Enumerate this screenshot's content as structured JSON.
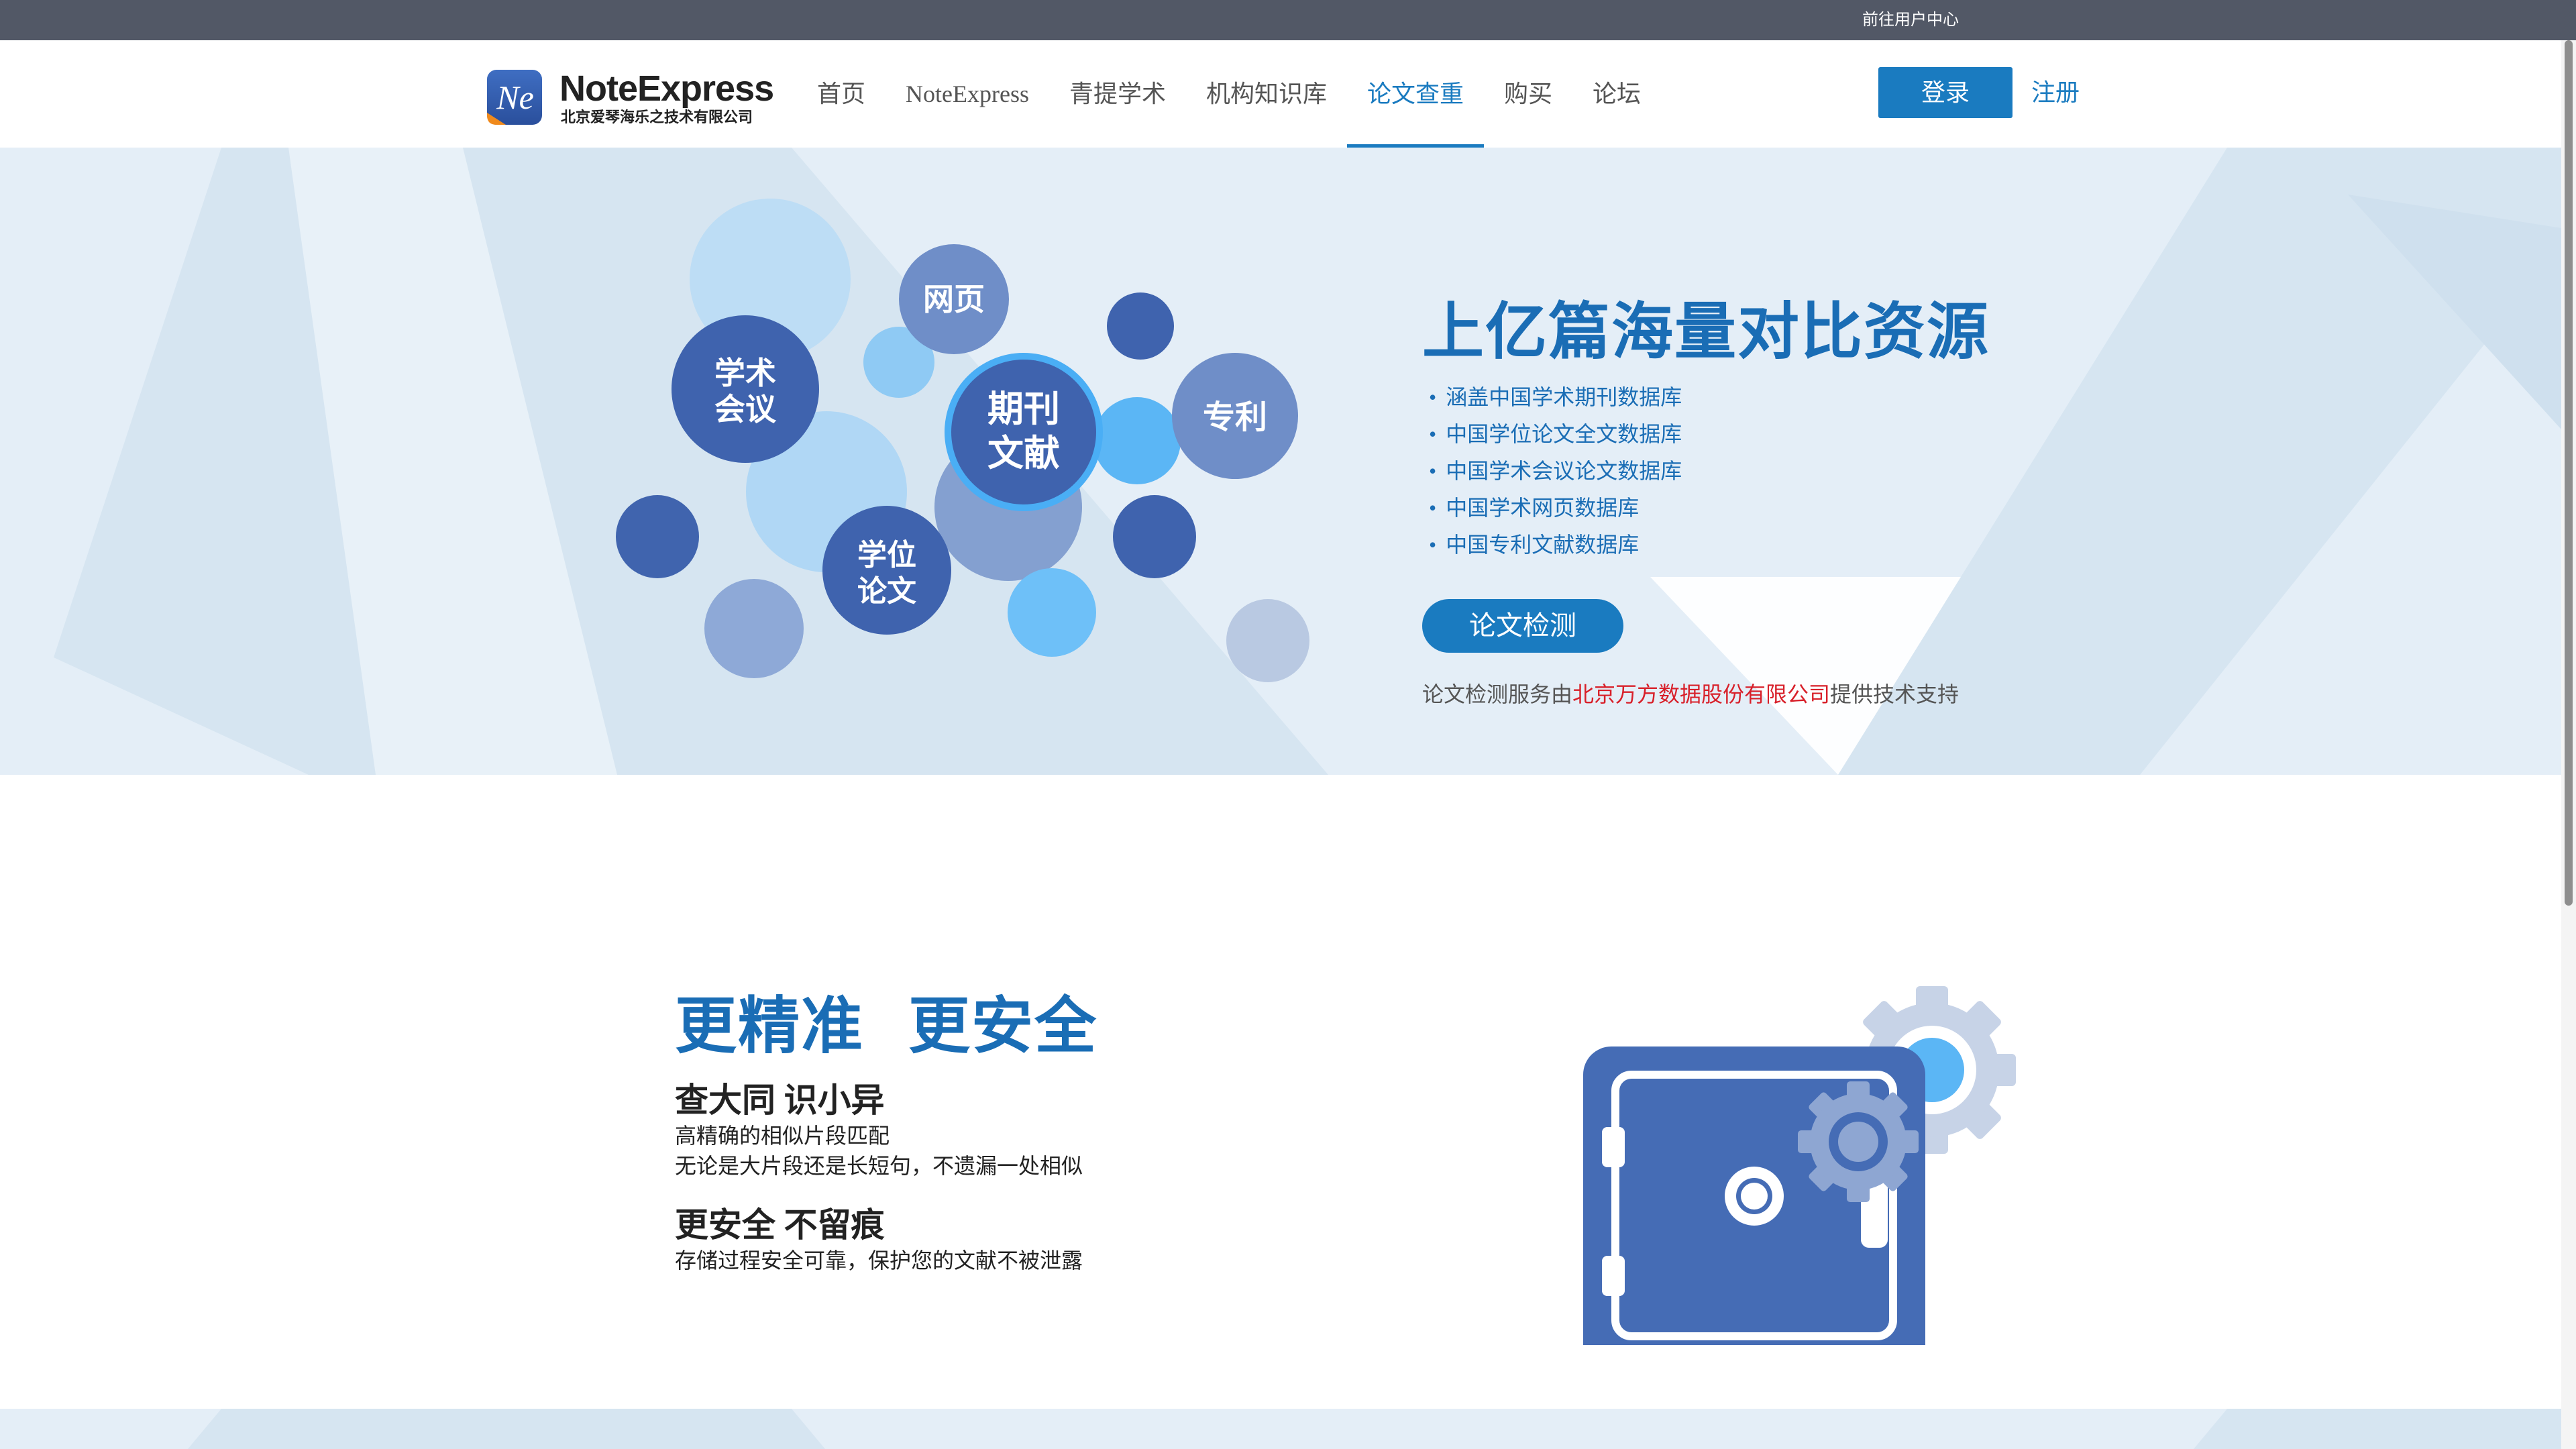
{
  "topbar": {
    "user_center": "前往用户中心"
  },
  "header": {
    "logo": {
      "mark_text": "Ne",
      "name": "NoteExpress",
      "company": "北京爱琴海乐之技术有限公司"
    },
    "nav": [
      {
        "label": "首页",
        "active": false
      },
      {
        "label": "NoteExpress",
        "active": false
      },
      {
        "label": "青提学术",
        "active": false
      },
      {
        "label": "机构知识库",
        "active": false
      },
      {
        "label": "论文查重",
        "active": true
      },
      {
        "label": "购买",
        "active": false
      },
      {
        "label": "论坛",
        "active": false
      }
    ],
    "login_label": "登录",
    "register_label": "注册"
  },
  "hero": {
    "bubbles": {
      "web": "网页",
      "conference_line1": "学术",
      "conference_line2": "会议",
      "journal_line1": "期刊",
      "journal_line2": "文献",
      "patent": "专利",
      "degree_line1": "学位",
      "degree_line2": "论文"
    },
    "headline": "上亿篇海量对比资源",
    "databases": [
      "涵盖中国学术期刊数据库",
      "中国学位论文全文数据库",
      "中国学术会议论文数据库",
      "中国学术网页数据库",
      "中国专利文献数据库"
    ],
    "check_button": "论文检测",
    "support_prefix": "论文检测服务由",
    "support_company": "北京万方数据股份有限公司",
    "support_suffix": "提供技术支持"
  },
  "feature": {
    "title_part1": "更精准",
    "title_part2": "更安全",
    "block1": {
      "heading": "查大同 识小异",
      "line1": "高精确的相似片段匹配",
      "line2": "无论是大片段还是长短句，不遗漏一处相似"
    },
    "block2": {
      "heading": "更安全 不留痕",
      "line1": "存储过程安全可靠，保护您的文献不被泄露"
    }
  },
  "colors": {
    "accent": "#1a7bc0",
    "topbar": "#525866",
    "hero_bg": "#e4eef7",
    "highlight_red": "#d8202a",
    "safe_blue": "#456cb5"
  },
  "icons": {
    "logo": "ne-logo-icon",
    "safe": "safe-icon",
    "gear": "gear-icon"
  }
}
